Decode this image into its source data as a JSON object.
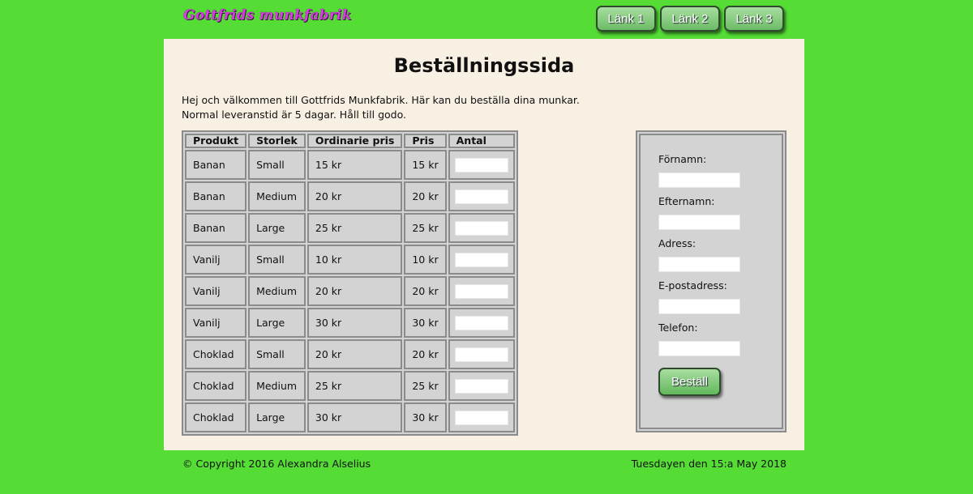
{
  "header": {
    "logo": "Gottfrids munkfabrik",
    "nav": [
      "Länk 1",
      "Länk 2",
      "Länk 3"
    ]
  },
  "main": {
    "title": "Beställningssida",
    "intro_line1": "Hej och välkommen till Gottfrids Munkfabrik. Här kan du beställa dina munkar.",
    "intro_line2": "Normal leveranstid är 5 dagar. Håll till godo."
  },
  "table": {
    "headers": [
      "Produkt",
      "Storlek",
      "Ordinarie pris",
      "Pris",
      "Antal"
    ],
    "rows": [
      {
        "product": "Banan",
        "size": "Small",
        "regular_price": "15 kr",
        "price": "15 kr",
        "quantity": ""
      },
      {
        "product": "Banan",
        "size": "Medium",
        "regular_price": "20 kr",
        "price": "20 kr",
        "quantity": ""
      },
      {
        "product": "Banan",
        "size": "Large",
        "regular_price": "25 kr",
        "price": "25 kr",
        "quantity": ""
      },
      {
        "product": "Vanilj",
        "size": "Small",
        "regular_price": "10 kr",
        "price": "10 kr",
        "quantity": ""
      },
      {
        "product": "Vanilj",
        "size": "Medium",
        "regular_price": "20 kr",
        "price": "20 kr",
        "quantity": ""
      },
      {
        "product": "Vanilj",
        "size": "Large",
        "regular_price": "30 kr",
        "price": "30 kr",
        "quantity": ""
      },
      {
        "product": "Choklad",
        "size": "Small",
        "regular_price": "20 kr",
        "price": "20 kr",
        "quantity": ""
      },
      {
        "product": "Choklad",
        "size": "Medium",
        "regular_price": "25 kr",
        "price": "25 kr",
        "quantity": ""
      },
      {
        "product": "Choklad",
        "size": "Large",
        "regular_price": "30 kr",
        "price": "30 kr",
        "quantity": ""
      }
    ]
  },
  "form": {
    "fields": [
      {
        "label": "Förnamn:",
        "value": ""
      },
      {
        "label": "Efternamn:",
        "value": ""
      },
      {
        "label": "Adress:",
        "value": ""
      },
      {
        "label": "E-postadress:",
        "value": ""
      },
      {
        "label": "Telefon:",
        "value": ""
      }
    ],
    "submit_label": "Beställ"
  },
  "footer": {
    "copyright": "© Copyright 2016 Alexandra Alselius",
    "date": "Tuesdayen den 15:a May 2018"
  },
  "colors": {
    "page_background": "#55dd36",
    "content_background": "#f7f0e3",
    "table_background": "#d3d3d3",
    "logo_color": "#d73be0",
    "button_green": "#6cbc66"
  }
}
